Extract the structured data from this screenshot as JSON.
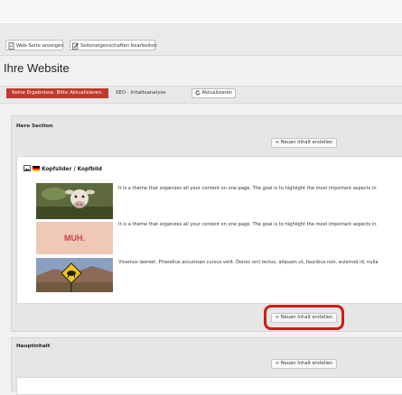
{
  "toolbar": {
    "view_website": "Web-Seite anzeigen",
    "edit_page_props": "Seiteneigenschaften bearbeiten"
  },
  "page": {
    "title": "Ihre Website"
  },
  "status": {
    "badge": "Keine Ergebnisse. Bitte Aktualisieren.",
    "seo_label": "SEO - Inhaltsanalyse",
    "refresh_label": "Aktualisieren"
  },
  "hero": {
    "title": "Hero Section",
    "new_content_label": "+ Neuen Inhalt erstellen",
    "card": {
      "title": "Kopfslider / Kopfbild",
      "items": [
        {
          "text": "It is a theme that organizes all your content on one page. The goal is to highlight the most important aspects in",
          "image": "cow-photo"
        },
        {
          "text": "It is a theme that organizes all your content on one page. The goal is to highlight the most important aspects in",
          "image": "muh-tile",
          "image_text": "MUH."
        },
        {
          "text": "Vivamus laoreet. Phasellus accumsan cursus velit. Donec orci lectus, aliquam ut, faucibus non, euismod id, nulla",
          "image": "cow-crossing-sign-photo"
        }
      ],
      "new_content_label": "+ Neuen Inhalt erstellen"
    }
  },
  "main": {
    "title": "Hauptinhalt",
    "new_content_label": "+ Neuen Inhalt erstellen"
  },
  "colors": {
    "badge_red": "#c0392b",
    "annotation_red": "#d11a1a"
  }
}
